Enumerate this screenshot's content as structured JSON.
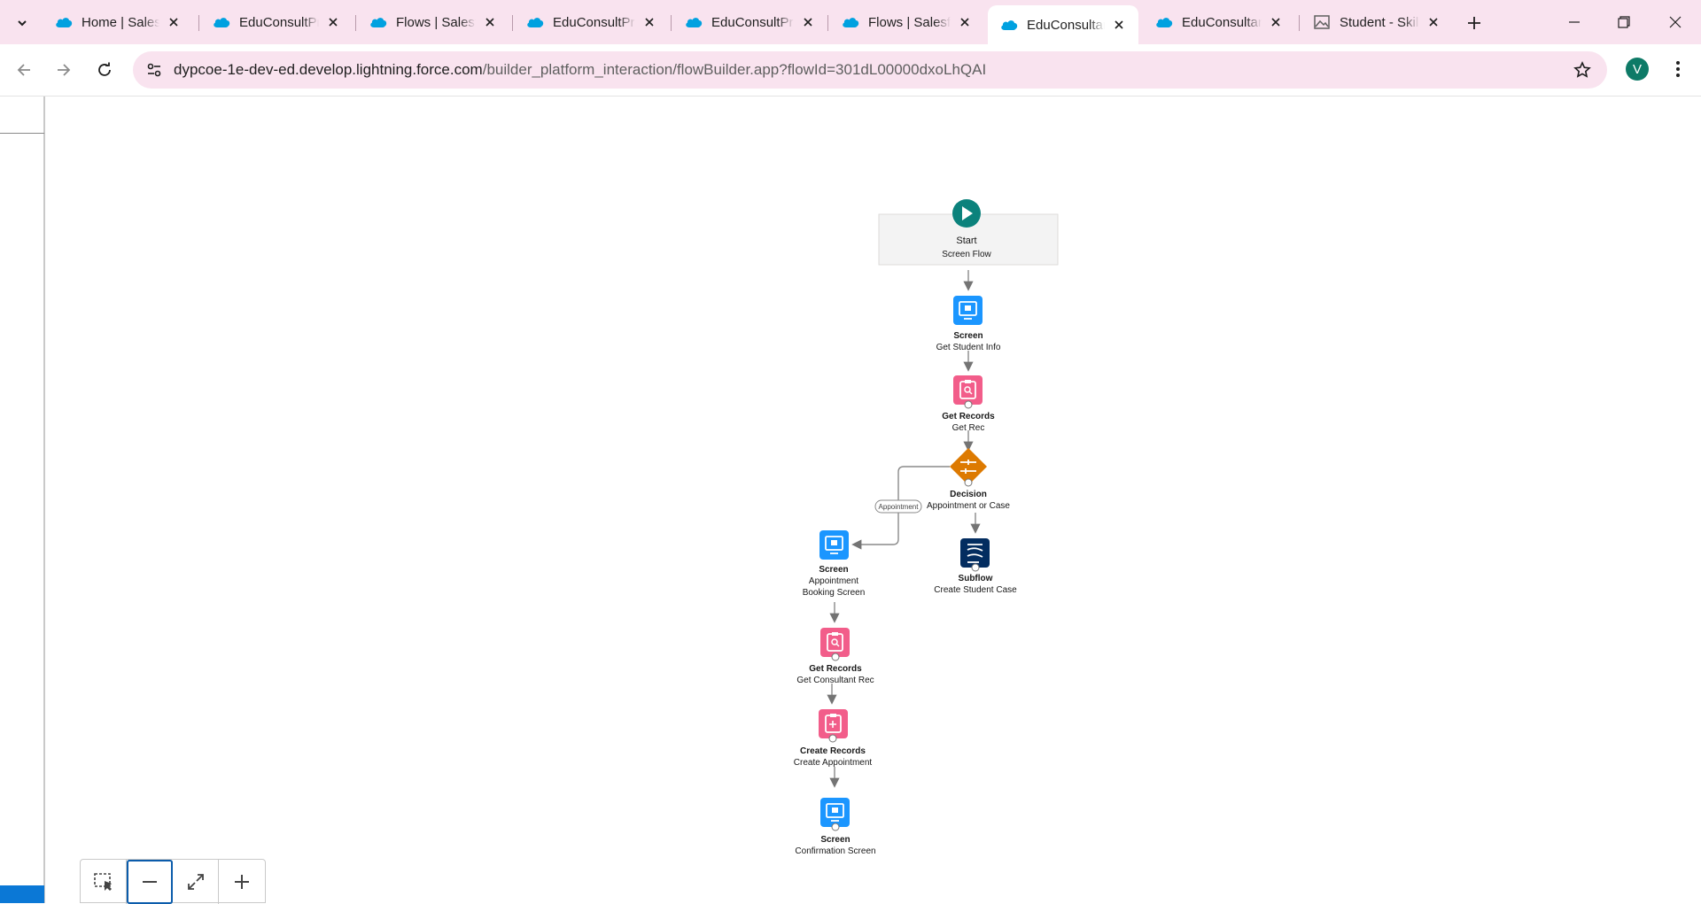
{
  "browser": {
    "tabs": [
      {
        "title": "Home | Salesforce",
        "icon": "salesforce-cloud-icon",
        "active": false
      },
      {
        "title": "EduConsultPro",
        "icon": "salesforce-cloud-icon",
        "active": false
      },
      {
        "title": "Flows | Salesforce",
        "icon": "salesforce-cloud-icon",
        "active": false
      },
      {
        "title": "EduConsultPro",
        "icon": "salesforce-cloud-icon",
        "active": false
      },
      {
        "title": "EduConsultPro",
        "icon": "salesforce-cloud-icon",
        "active": false
      },
      {
        "title": "Flows | Salesforce",
        "icon": "salesforce-cloud-icon",
        "active": false
      },
      {
        "title": "EduConsultant",
        "icon": "salesforce-cloud-icon",
        "active": true
      },
      {
        "title": "EduConsultant",
        "icon": "salesforce-cloud-icon",
        "active": false
      },
      {
        "title": "Student - Skill",
        "icon": "image-icon",
        "active": false
      }
    ],
    "url_host": "dypcoe-1e-dev-ed.develop.lightning.force.com",
    "url_path": "/builder_platform_interaction/flowBuilder.app?flowId=301dL00000dxoLhQAI",
    "profile_initial": "V",
    "accent": "#f9e3ef"
  },
  "flow": {
    "start": {
      "title": "Start",
      "subtitle": "Screen Flow"
    },
    "nodes": {
      "screen1": {
        "type": "Screen",
        "label": "Get Student Info"
      },
      "get1": {
        "type": "Get Records",
        "label": "Get Rec"
      },
      "decision": {
        "type": "Decision",
        "label": "Appointment or Case"
      },
      "screen2": {
        "type": "Screen",
        "label_line1": "Appointment",
        "label_line2": "Booking Screen"
      },
      "subflow": {
        "type": "Subflow",
        "label": "Create Student Case"
      },
      "get2": {
        "type": "Get Records",
        "label": "Get Consultant Rec"
      },
      "create1": {
        "type": "Create Records",
        "label": "Create Appointment"
      },
      "screen3": {
        "type": "Screen",
        "label": "Confirmation Screen"
      }
    },
    "branch_label": "Appointment",
    "colors": {
      "screen": "#1b96ff",
      "records": "#f25d8a",
      "decision": "#dd7a01",
      "subflow": "#032d60",
      "start": "#0b827c"
    }
  }
}
